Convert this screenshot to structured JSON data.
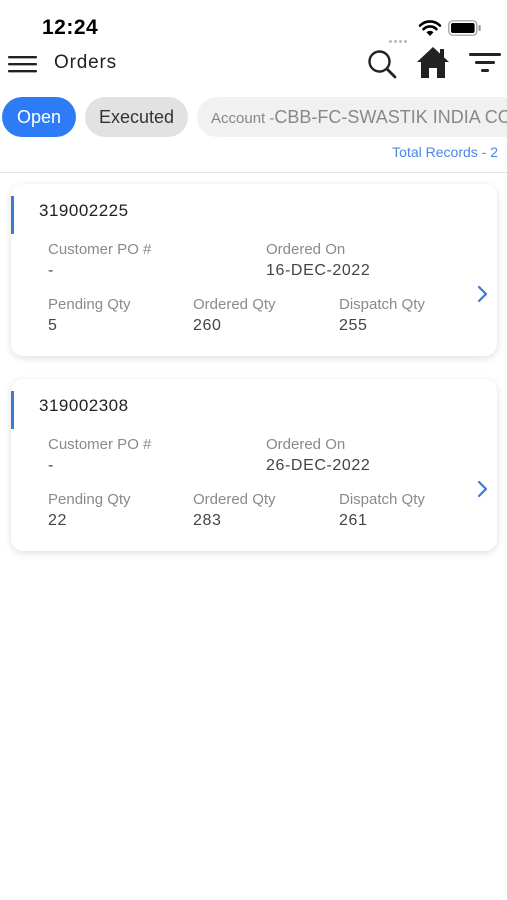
{
  "status_bar": {
    "time": "12:24"
  },
  "header": {
    "title": "Orders"
  },
  "filters": {
    "open_label": "Open",
    "executed_label": "Executed",
    "account_prefix": "Account -",
    "account_value": "CBB-FC-SWASTIK INDIA CO-D"
  },
  "total_records": "Total Records - 2",
  "labels": {
    "customer_po": "Customer PO #",
    "ordered_on": "Ordered On",
    "pending_qty": "Pending Qty",
    "ordered_qty": "Ordered Qty",
    "dispatch_qty": "Dispatch Qty"
  },
  "orders": [
    {
      "id": "319002225",
      "customer_po": "-",
      "ordered_on": "16-DEC-2022",
      "pending_qty": "5",
      "ordered_qty": "260",
      "dispatch_qty": "255"
    },
    {
      "id": "319002308",
      "customer_po": "-",
      "ordered_on": "26-DEC-2022",
      "pending_qty": "22",
      "ordered_qty": "283",
      "dispatch_qty": "261"
    }
  ],
  "colors": {
    "accent": "#2d7cf6",
    "link": "#4a86e8",
    "card_bar": "#3a7bd5"
  }
}
